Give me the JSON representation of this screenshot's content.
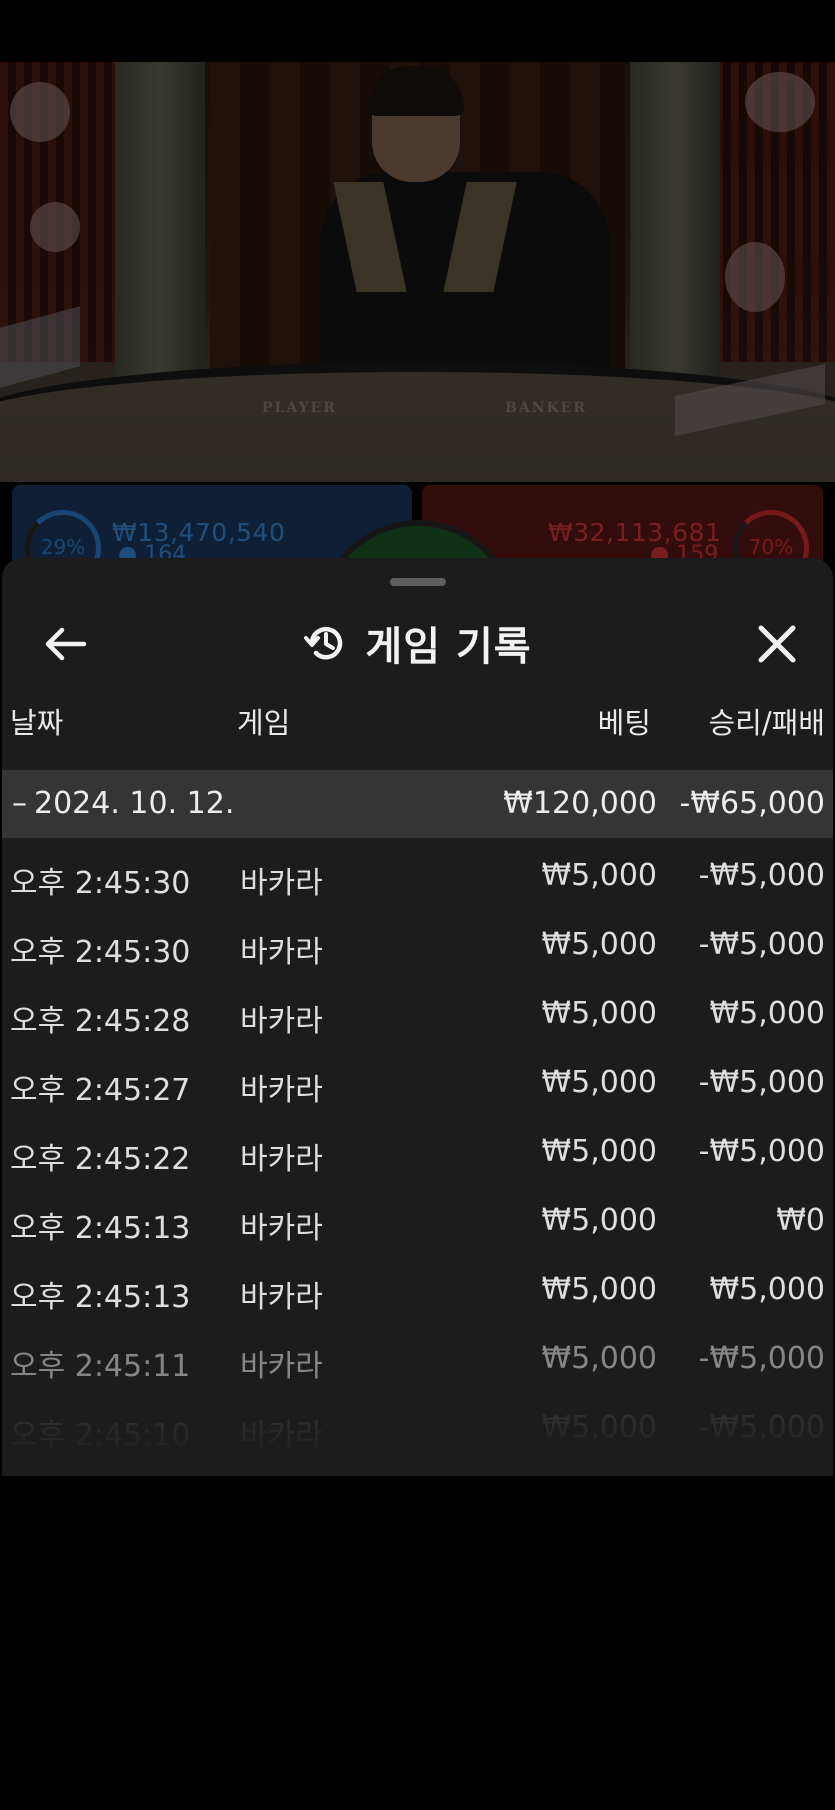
{
  "video": {
    "table_player_label": "PLAYER",
    "table_banker_label": "BANKER",
    "player_percent": "29%",
    "player_amount": "₩13,470,540",
    "player_count": "164",
    "banker_percent": "70%",
    "banker_amount": "₩32,113,681",
    "banker_count": "159"
  },
  "sheet": {
    "title": "게임 기록",
    "title_icon": "history-icon",
    "back_icon": "arrow-left-icon",
    "close_icon": "close-icon",
    "columns": {
      "date": "날짜",
      "game": "게임",
      "bet": "베팅",
      "win_loss": "승리/패배"
    },
    "date_group": {
      "toggle": "–",
      "date": "2024. 10. 12.",
      "bet_total": "₩120,000",
      "win_loss_total": "-₩65,000"
    },
    "rows": [
      {
        "time": "오후 2:45:30",
        "game": "바카라",
        "bet": "₩5,000",
        "win_loss": "-₩5,000"
      },
      {
        "time": "오후 2:45:30",
        "game": "바카라",
        "bet": "₩5,000",
        "win_loss": "-₩5,000"
      },
      {
        "time": "오후 2:45:28",
        "game": "바카라",
        "bet": "₩5,000",
        "win_loss": "₩5,000"
      },
      {
        "time": "오후 2:45:27",
        "game": "바카라",
        "bet": "₩5,000",
        "win_loss": "-₩5,000"
      },
      {
        "time": "오후 2:45:22",
        "game": "바카라",
        "bet": "₩5,000",
        "win_loss": "-₩5,000"
      },
      {
        "time": "오후 2:45:13",
        "game": "바카라",
        "bet": "₩5,000",
        "win_loss": "₩0"
      },
      {
        "time": "오후 2:45:13",
        "game": "바카라",
        "bet": "₩5,000",
        "win_loss": "₩5,000"
      },
      {
        "time": "오후 2:45:11",
        "game": "바카라",
        "bet": "₩5,000",
        "win_loss": "-₩5,000"
      },
      {
        "time": "오후 2:45:10",
        "game": "바카라",
        "bet": "₩5,000",
        "win_loss": "-₩5,000"
      }
    ]
  },
  "colors": {
    "sheet_bg": "#1c1c1c",
    "date_row_bg": "#353535",
    "player_blue": "#2f7fd6",
    "banker_red": "#d62f2f"
  }
}
